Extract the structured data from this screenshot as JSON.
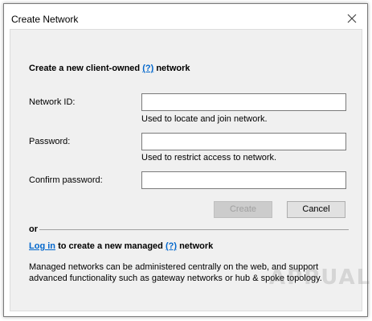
{
  "window": {
    "title": "Create Network"
  },
  "form": {
    "heading_prefix": "Create a new client-owned",
    "heading_help": "(?)",
    "heading_suffix": "network",
    "network_id": {
      "label": "Network ID:",
      "value": "",
      "hint": "Used to locate and join network."
    },
    "password": {
      "label": "Password:",
      "value": "",
      "hint": "Used to restrict access to network."
    },
    "confirm_password": {
      "label": "Confirm password:",
      "value": ""
    },
    "create_label": "Create",
    "cancel_label": "Cancel"
  },
  "alternative": {
    "or_label": "or",
    "login_link": "Log in",
    "managed_text_prefix": "to create a new managed",
    "managed_help": "(?)",
    "managed_text_suffix": "network",
    "description": "Managed networks can be administered centrally on the web, and support advanced functionality such as gateway networks or hub & spoke topology."
  },
  "watermark": {
    "text": "APPUALS"
  },
  "colors": {
    "link": "#0066cc",
    "dialog_bg": "#f0f0f0",
    "button_bg": "#e1e1e1",
    "disabled_text": "#a0a0a0"
  }
}
